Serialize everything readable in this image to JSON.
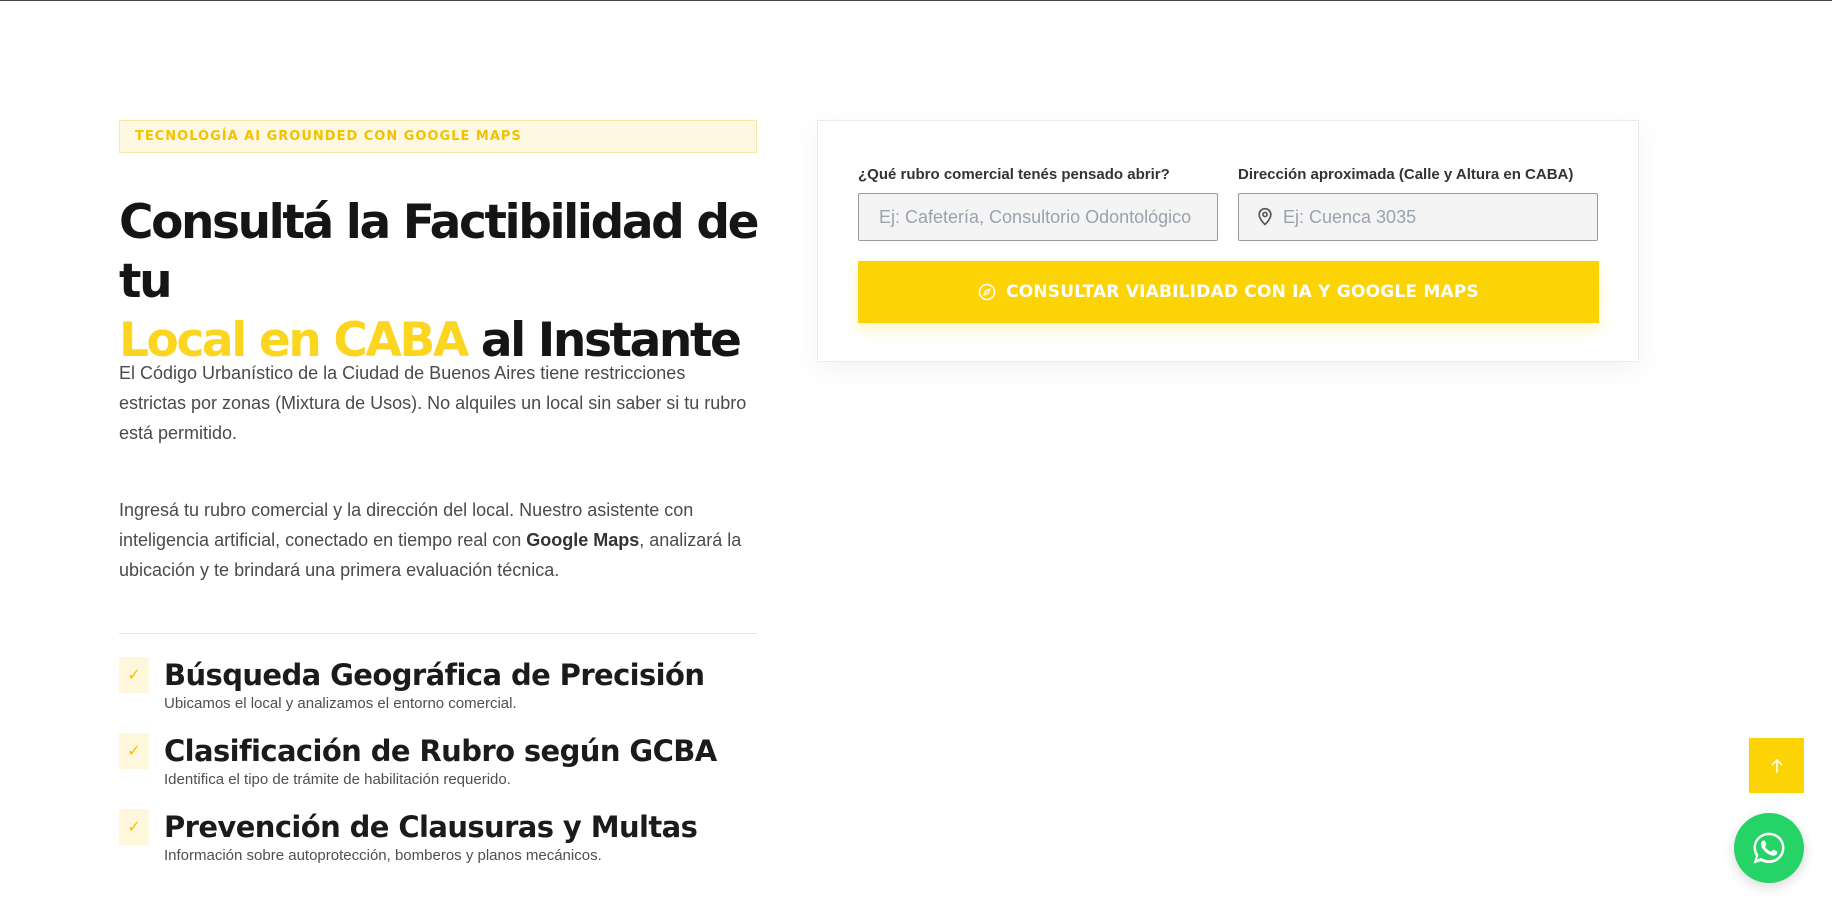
{
  "hero": {
    "badge": "TECNOLOGÍA AI GROUNDED CON GOOGLE MAPS",
    "headline_part1": "Consultá la Factibilidad de tu",
    "headline_highlight": "Local en CABA",
    "headline_part2": " al Instante",
    "para1": "El Código Urbanístico de la Ciudad de Buenos Aires tiene restricciones estrictas por zonas (Mixtura de Usos). No alquiles un local sin saber si tu rubro está permitido.",
    "para2_before": "Ingresá tu rubro comercial y la dirección del local. Nuestro asistente con inteligencia artificial, conectado en tiempo real con ",
    "para2_bold": "Google Maps",
    "para2_after": ", analizará la ubicación y te brindará una primera evaluación técnica."
  },
  "features": [
    {
      "title": "Búsqueda Geográfica de Precisión",
      "desc": "Ubicamos el local y analizamos el entorno comercial.",
      "icon": "check-icon"
    },
    {
      "title": "Clasificación de Rubro según GCBA",
      "desc": "Identifica el tipo de trámite de habilitación requerido.",
      "icon": "check-icon"
    },
    {
      "title": "Prevención de Clausuras y Multas",
      "desc": "Información sobre autoprotección, bomberos y planos mecánicos.",
      "icon": "check-icon"
    }
  ],
  "form": {
    "rubro_label": "¿Qué rubro comercial tenés pensado abrir?",
    "rubro_placeholder": "Ej: Cafetería, Consultorio Odontológico",
    "rubro_value": "",
    "direccion_label": "Dirección aproximada (Calle y Altura en CABA)",
    "direccion_placeholder": "Ej: Cuenca 3035",
    "direccion_value": "",
    "direccion_icon": "map-pin-icon",
    "submit_label": "CONSULTAR VIABILIDAD CON IA Y GOOGLE MAPS",
    "submit_icon": "compass-icon"
  },
  "floating": {
    "scroll_top_icon": "arrow-up-icon",
    "whatsapp_icon": "whatsapp-icon"
  },
  "colors": {
    "accent": "#fcd406",
    "highlight_text": "#fcd520",
    "badge_bg": "#fef8e1",
    "whatsapp": "#25d366"
  }
}
